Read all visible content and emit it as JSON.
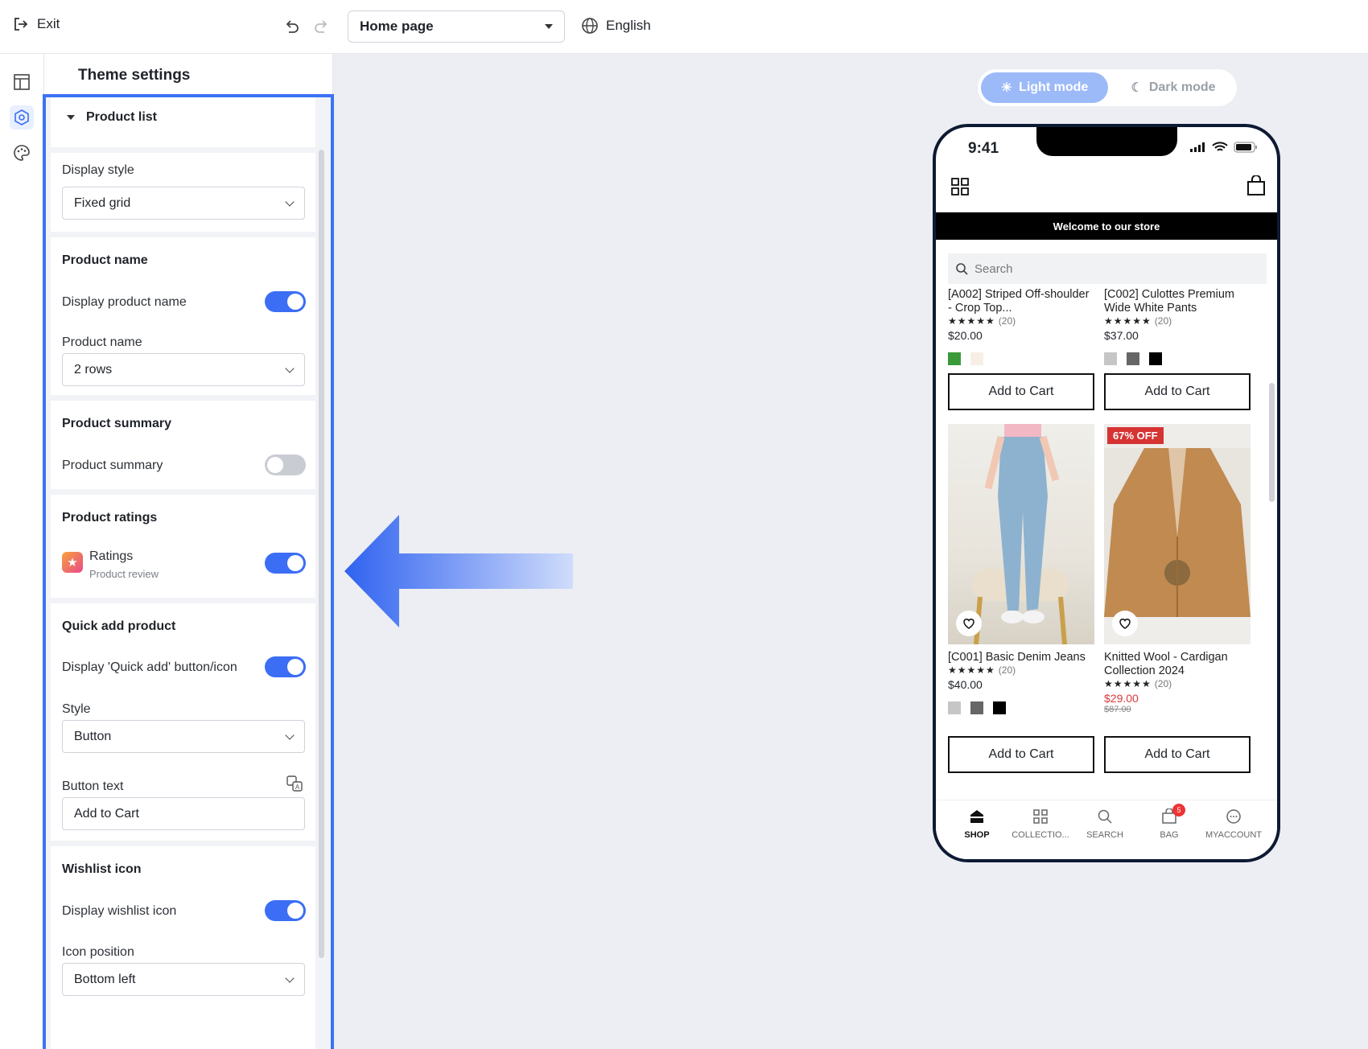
{
  "topbar": {
    "exit_label": "Exit",
    "page_select": "Home page",
    "language": "English"
  },
  "panel": {
    "title": "Theme settings",
    "product_list": {
      "heading": "Product list",
      "display_style_label": "Display style",
      "display_style_value": "Fixed grid"
    },
    "product_name": {
      "heading": "Product name",
      "toggle_label": "Display product name",
      "toggle_on": true,
      "rows_label": "Product name",
      "rows_value": "2 rows"
    },
    "product_summary": {
      "heading": "Product summary",
      "toggle_label": "Product summary",
      "toggle_on": false
    },
    "product_ratings": {
      "heading": "Product ratings",
      "app_name": "Ratings",
      "app_sub": "Product review",
      "toggle_on": true
    },
    "quick_add": {
      "heading": "Quick add product",
      "toggle_label": "Display 'Quick add' button/icon",
      "toggle_on": true,
      "style_label": "Style",
      "style_value": "Button",
      "button_text_label": "Button text",
      "button_text_value": "Add to Cart"
    },
    "wishlist": {
      "heading": "Wishlist icon",
      "toggle_label": "Display wishlist icon",
      "toggle_on": true,
      "position_label": "Icon position",
      "position_value": "Bottom left"
    }
  },
  "preview": {
    "mode_light": "Light mode",
    "mode_dark": "Dark mode",
    "active_mode": "light",
    "phone": {
      "time": "9:41",
      "welcome": "Welcome to our store",
      "search_placeholder": "Search",
      "products": [
        {
          "name": "[A002] Striped Off-shoulder - Crop Top...",
          "stars": "★★★★★",
          "reviews": "(20)",
          "price": "$20.00",
          "swatches": [
            "#3a9a3a",
            "#f7efe6"
          ],
          "button": "Add to Cart"
        },
        {
          "name": "[C002] Culottes Premium Wide White Pants",
          "stars": "★★★★★",
          "reviews": "(20)",
          "price": "$37.00",
          "swatches": [
            "#c6c6c6",
            "#666666",
            "#000000"
          ],
          "button": "Add to Cart"
        },
        {
          "name": "[C001] Basic Denim Jeans",
          "stars": "★★★★★",
          "reviews": "(20)",
          "price": "$40.00",
          "swatches": [
            "#c6c6c6",
            "#666666",
            "#000000"
          ],
          "button": "Add to Cart"
        },
        {
          "name": "Knitted Wool - Cardigan Collection 2024",
          "stars": "★★★★★",
          "reviews": "(20)",
          "price": "$29.00",
          "old_price": "$87.00",
          "badge": "67% OFF",
          "button": "Add to Cart"
        }
      ],
      "tabs": [
        "SHOP",
        "COLLECTIO...",
        "SEARCH",
        "BAG",
        "MYACCOUNT"
      ],
      "bag_count": "5"
    }
  },
  "colors": {
    "accent": "#3b6ef5",
    "highlight": "#3b73f5",
    "sale": "#d63333"
  }
}
